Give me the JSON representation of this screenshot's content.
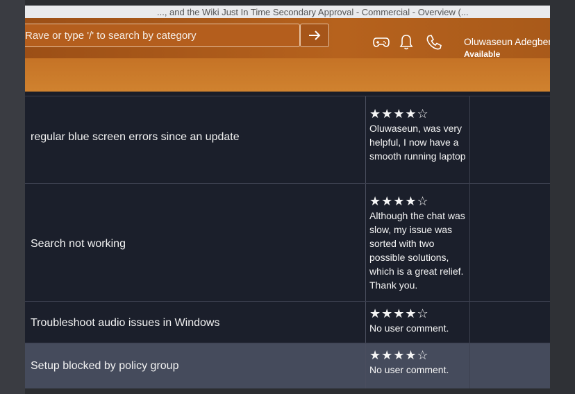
{
  "browser": {
    "tab_title": "..., and the Wiki Just In Time Secondary Approval - Commercial - Overview (..."
  },
  "header": {
    "search_placeholder": "Rave or type '/' to search by category",
    "user_name": "Oluwaseun Adegbem",
    "user_status": "Available",
    "icons": [
      "gamepad-icon",
      "bell-icon",
      "phone-icon",
      "arrow-right-icon"
    ]
  },
  "table": {
    "rows": [
      {
        "title": "regular blue screen errors since an update",
        "rating": 4,
        "stars": "★★★★☆",
        "comment": "Oluwaseun, was very helpful, I now have a smooth running laptop"
      },
      {
        "title": "Search not working",
        "rating": 4,
        "stars": "★★★★☆",
        "comment": "Although the chat was slow, my issue was sorted with two possible solutions, which is a great relief. Thank you."
      },
      {
        "title": "Troubleshoot audio issues in Windows",
        "rating": 4,
        "stars": "★★★★☆",
        "comment": "No user comment."
      },
      {
        "title": "Setup blocked by policy group",
        "rating": 4,
        "stars": "★★★★☆",
        "comment": "No user comment."
      }
    ]
  },
  "colors": {
    "header_orange": "#b6621d",
    "table_bg": "#1b1f2b",
    "highlight_row": "#454b5c"
  }
}
